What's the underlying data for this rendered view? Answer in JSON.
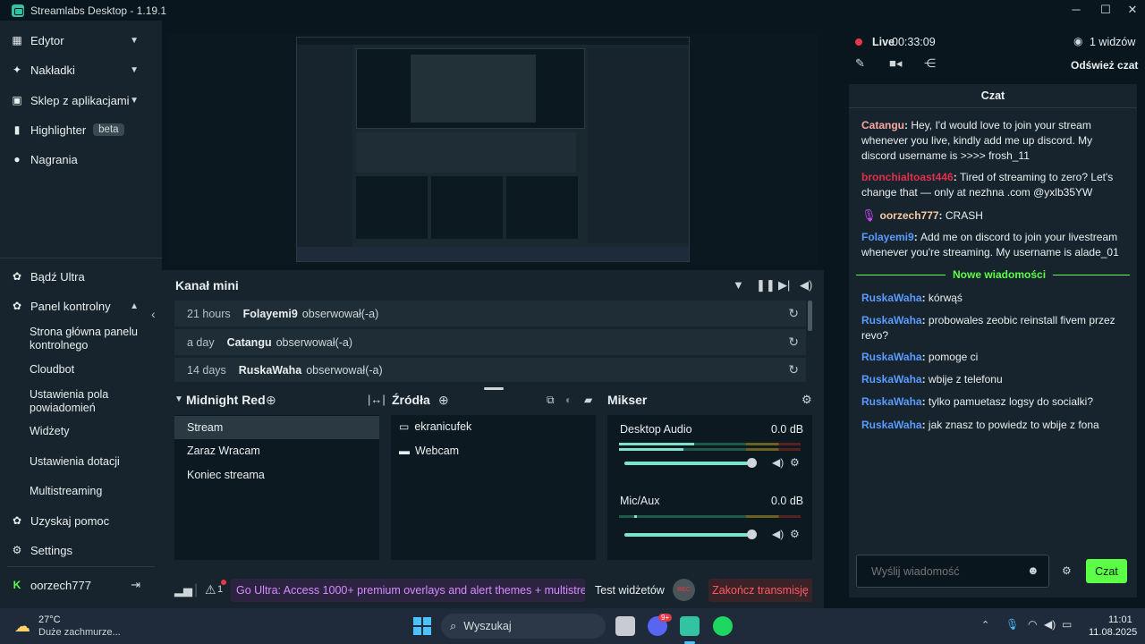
{
  "window": {
    "title": "Streamlabs Desktop - 1.19.1"
  },
  "sidebar": {
    "top_items": [
      {
        "label": "Edytor",
        "icon": "editor-icon"
      },
      {
        "label": "Nakładki",
        "icon": "overlays-icon"
      },
      {
        "label": "Sklep z aplikacjami",
        "icon": "app-store-icon"
      },
      {
        "label": "Highlighter",
        "icon": "highlighter-icon",
        "badge": "beta"
      },
      {
        "label": "Nagrania",
        "icon": "recordings-icon"
      }
    ],
    "ultra": "Bądź Ultra",
    "dashboard": "Panel kontrolny",
    "dashboard_sub": [
      "Strona główna panelu kontrolnego",
      "Cloudbot",
      "Ustawienia pola powiadomień",
      "Widżety",
      "Ustawienia dotacji",
      "Multistreaming"
    ],
    "help": "Uzyskaj pomoc",
    "settings": "Settings",
    "user": "oorzech777"
  },
  "mini_feed": {
    "title": "Kanał mini",
    "events": [
      {
        "time": "21 hours",
        "name": "Folayemi9",
        "action": "obserwował(-a)"
      },
      {
        "time": "a day",
        "name": "Catangu",
        "action": "obserwował(-a)"
      },
      {
        "time": "14 days",
        "name": "RuskaWaha",
        "action": "obserwował(-a)"
      }
    ]
  },
  "scenes": {
    "title": "Midnight Red",
    "items": [
      "Stream",
      "Zaraz Wracam",
      "Koniec streama"
    ],
    "selected": 0
  },
  "sources": {
    "title": "Źródła",
    "items": [
      {
        "label": "ekranicufek",
        "icon": "monitor-icon"
      },
      {
        "label": "Webcam",
        "icon": "folder-icon"
      }
    ]
  },
  "mixer": {
    "title": "Mikser",
    "channels": [
      {
        "name": "Desktop Audio",
        "db": "0.0 dB",
        "level": 0.98
      },
      {
        "name": "Mic/Aux",
        "db": "0.0 dB",
        "level": 0.98
      }
    ]
  },
  "status_bar": {
    "alerts_count": "1",
    "promo": "Go Ultra: Access 1000+ premium overlays and alert themes + multistream...",
    "test_widgets": "Test widżetów",
    "rec": "REC",
    "end_stream": "Zakończ transmisję"
  },
  "live": {
    "label": "Live",
    "time": "00:33:09",
    "viewers": "1 widzów",
    "refresh": "Odśwież czat"
  },
  "chat": {
    "title": "Czat",
    "messages": [
      {
        "user": "Catangu",
        "color": "#f7a9a0",
        "text": "Hey, I'd would love to join your stream whenever you live, kindly add me up discord. My discord username is >>>> frosh_11"
      },
      {
        "user": "bronchialtoast446",
        "color": "#e0304a",
        "text": "Tired of streaming to zero? Let's change that — only at nezhna .com @yxlb35YW"
      },
      {
        "user": "oorzech777",
        "color": "#f7c9a0",
        "text": "CRASH"
      },
      {
        "user": "Folayemi9",
        "color": "#5a9bff",
        "text": "Add me on discord to join your livestream whenever you're streaming. My username is alade_01"
      }
    ],
    "new_messages": "Nowe wiadomości",
    "new": [
      {
        "user": "RuskaWaha",
        "text": "kórwąś"
      },
      {
        "user": "RuskaWaha",
        "text": "probowales zeobic reinstall fivem przez revo?"
      },
      {
        "user": "RuskaWaha",
        "text": "pomoge ci"
      },
      {
        "user": "RuskaWaha",
        "text": "wbije z telefonu"
      },
      {
        "user": "RuskaWaha",
        "text": "tylko pamuetasz logsy do socialki?"
      },
      {
        "user": "RuskaWaha",
        "text": "jak znasz to powiedz to wbije z fona"
      }
    ],
    "input_placeholder": "Wyślij wiadomość",
    "send": "Czat"
  },
  "taskbar": {
    "weather_temp": "27°C",
    "weather_desc": "Duże zachmurze...",
    "search": "Wyszukaj",
    "discord_badge": "9+",
    "time": "11:01",
    "date": "11.08.2025"
  },
  "colors": {
    "accent": "#31c3a2",
    "new_msg": "#5bff45",
    "user_blue": "#5a9bff",
    "danger": "#e63946",
    "send_btn": "#5bff45"
  }
}
